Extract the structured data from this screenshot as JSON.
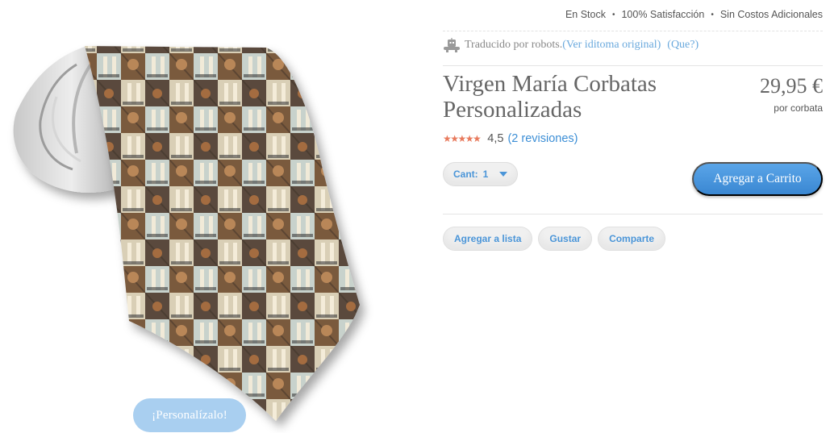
{
  "stock_bar": {
    "in_stock": "En Stock",
    "satisfaction": "100% Satisfacción",
    "no_costs": "Sin Costos Adicionales",
    "separator": "•"
  },
  "translation": {
    "icon": "robot-icon",
    "text": "Traducido por robots.",
    "original_link": "(Ver iditoma original)",
    "what_link": "(Que?)"
  },
  "product": {
    "title": "Virgen María Corbatas Personalizadas",
    "price": "29,95 €",
    "price_unit": "por corbata",
    "rating_stars": "★★★★★",
    "rating_value": "4,5",
    "reviews_link": "(2 revisiones)"
  },
  "quantity": {
    "label": "Cant:",
    "value": "1",
    "icon": "caret-down-icon"
  },
  "buttons": {
    "add_to_cart": "Agregar a Carrito",
    "add_to_list": "Agregar a lista",
    "like": "Gustar",
    "share": "Comparte",
    "customize": "¡Personalízalo!"
  },
  "colors": {
    "accent_blue": "#3d8fd6",
    "cart_button": "#4a96dc",
    "customize_button": "#a9cff0",
    "stars": "#e87a5d"
  }
}
